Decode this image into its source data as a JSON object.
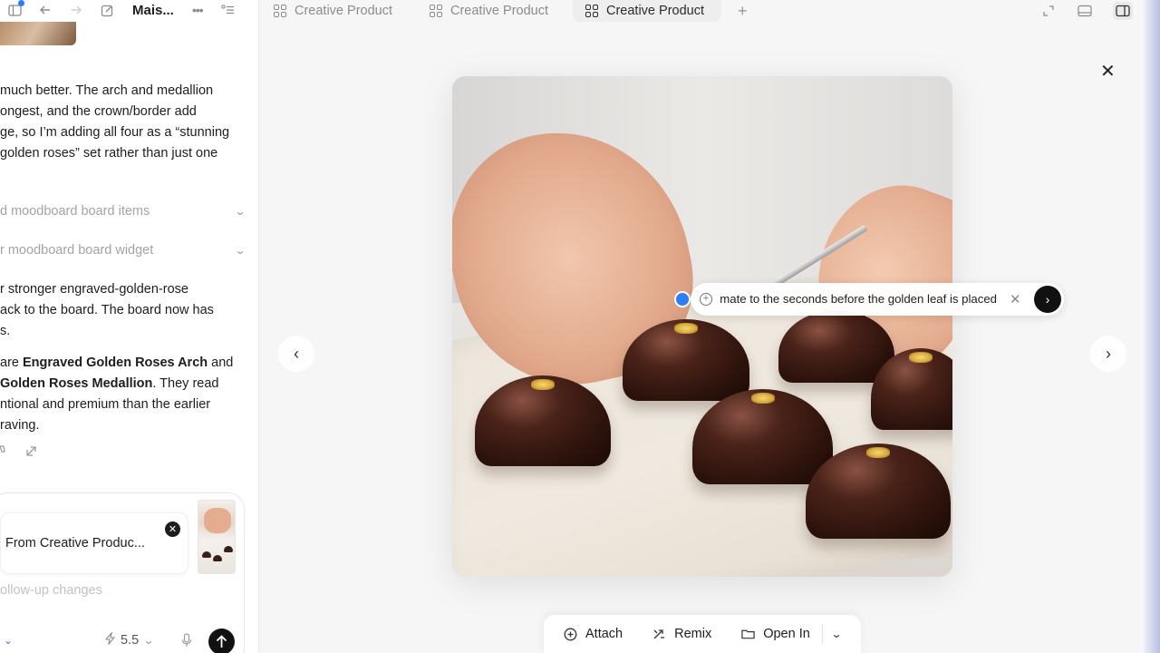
{
  "topbar": {
    "workspace_title": "Mais...",
    "icons": [
      "sidebar-icon",
      "back-icon",
      "forward-icon",
      "new-chat-icon",
      "more-icon",
      "list-icon"
    ]
  },
  "tabs": [
    {
      "label": "Creative Product",
      "active": false
    },
    {
      "label": "Creative Product",
      "active": false
    },
    {
      "label": "Creative Product",
      "active": true
    }
  ],
  "chat": {
    "lines_1": [
      "much better. The arch and medallion",
      "ongest, and the crown/border add",
      "ge, so I’m adding all four as a “stunning",
      "golden roses” set rather than just one"
    ],
    "tool_1": "d moodboard board items",
    "tool_2": "r moodboard board widget",
    "lines_2": [
      "r stronger engraved-golden-rose",
      "ack to the board. The board now has",
      "s."
    ],
    "para_3": {
      "l1_pre": "are ",
      "l1_bold": "Engraved Golden Roses Arch",
      "l1_post": " and",
      "l2_bold": "Golden Roses Medallion",
      "l2_post": ". They read",
      "l3": "ntional and premium than the earlier",
      "l4": "raving."
    }
  },
  "composer": {
    "attachment_label": "From Creative Produc...",
    "placeholder": "ollow-up changes",
    "model_value": "5.5"
  },
  "viewer": {
    "prompt_text": "Animate to the seconds before the golden leaf is placed",
    "actions": [
      {
        "label": "Attach",
        "icon": "attach-icon"
      },
      {
        "label": "Remix",
        "icon": "remix-icon"
      },
      {
        "label": "Open In",
        "icon": "folder-icon"
      }
    ]
  },
  "colors": {
    "accent": "#2f7df6",
    "send_button": "#111111",
    "chocolate": "#2c120c",
    "gold_leaf": "#d7a83a"
  }
}
